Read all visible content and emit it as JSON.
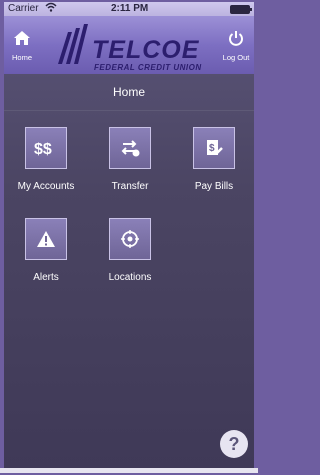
{
  "status": {
    "carrier": "Carrier",
    "wifi_icon": "wifi-icon",
    "time": "2:11 PM"
  },
  "navbar": {
    "home_label": "Home",
    "logo_name": "TELCOE",
    "logo_sub": "FEDERAL CREDIT UNION",
    "logout_label": "Log Out"
  },
  "page": {
    "title": "Home"
  },
  "tiles": [
    {
      "label": "My Accounts",
      "icon": "dollar-icon"
    },
    {
      "label": "Transfer",
      "icon": "transfer-icon"
    },
    {
      "label": "Pay Bills",
      "icon": "bill-icon"
    },
    {
      "label": "Alerts",
      "icon": "alert-icon"
    },
    {
      "label": "Locations",
      "icon": "location-icon"
    }
  ],
  "help": {
    "label": "?"
  },
  "colors": {
    "accent": "#7d6fc2",
    "background": "#4b4563",
    "logo": "#2c1e6e"
  }
}
